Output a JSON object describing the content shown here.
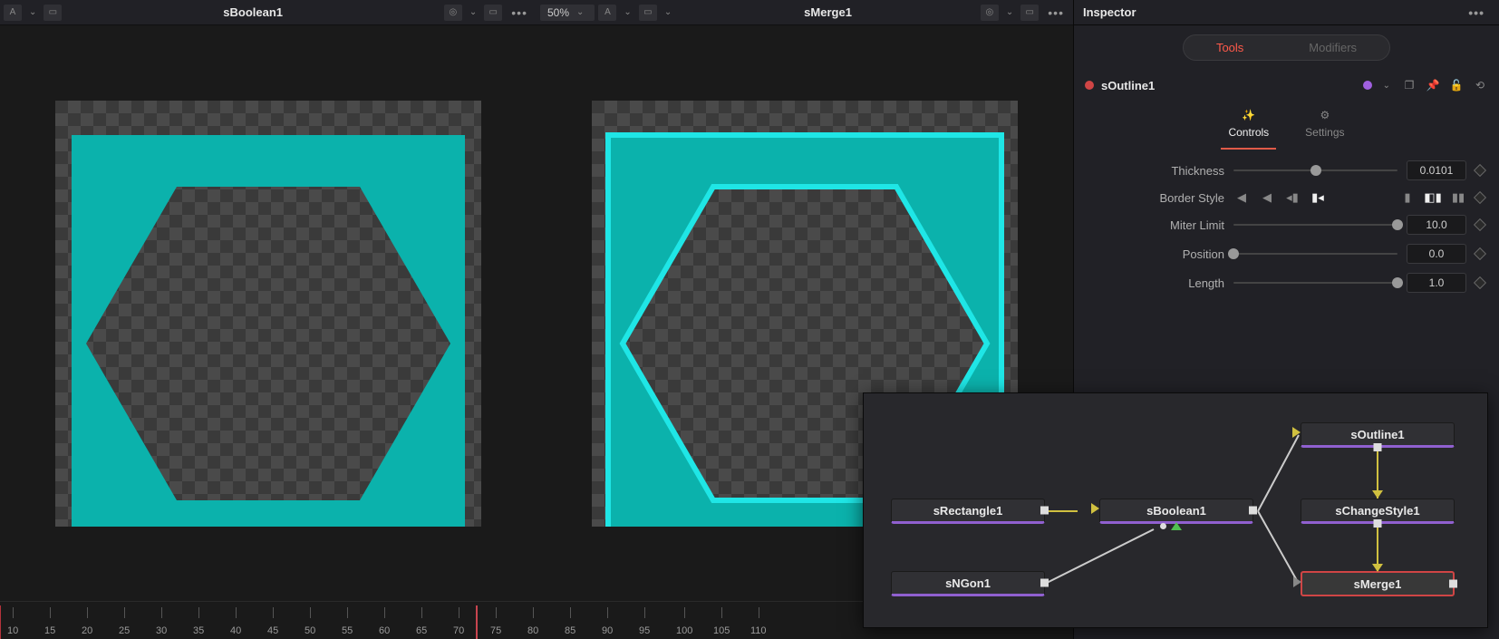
{
  "viewer1": {
    "title": "sBoolean1",
    "toolbar_label": "A"
  },
  "viewer2": {
    "title": "sMerge1",
    "zoom": "50%",
    "toolbar_label": "A"
  },
  "inspector": {
    "title": "Inspector",
    "tabs": {
      "tools": "Tools",
      "modifiers": "Modifiers"
    },
    "node_name": "sOutline1",
    "sub_tabs": {
      "controls": "Controls",
      "settings": "Settings"
    },
    "params": {
      "thickness": {
        "label": "Thickness",
        "value": "0.0101"
      },
      "border_style": {
        "label": "Border Style"
      },
      "miter_limit": {
        "label": "Miter Limit",
        "value": "10.0"
      },
      "position": {
        "label": "Position",
        "value": "0.0"
      },
      "length": {
        "label": "Length",
        "value": "1.0"
      }
    }
  },
  "nodes": {
    "rect": "sRectangle1",
    "ngon": "sNGon1",
    "boolean": "sBoolean1",
    "outline": "sOutline1",
    "changestyle": "sChangeStyle1",
    "merge": "sMerge1"
  },
  "ruler": {
    "ticks": [
      10,
      15,
      20,
      25,
      30,
      35,
      40,
      45,
      50,
      55,
      60,
      65,
      70,
      75,
      80,
      85,
      90,
      95,
      100,
      105,
      110
    ],
    "playhead": 73
  },
  "colors": {
    "shape_fill": "#0bb2ac",
    "outline_stroke": "#1fe6e6"
  }
}
